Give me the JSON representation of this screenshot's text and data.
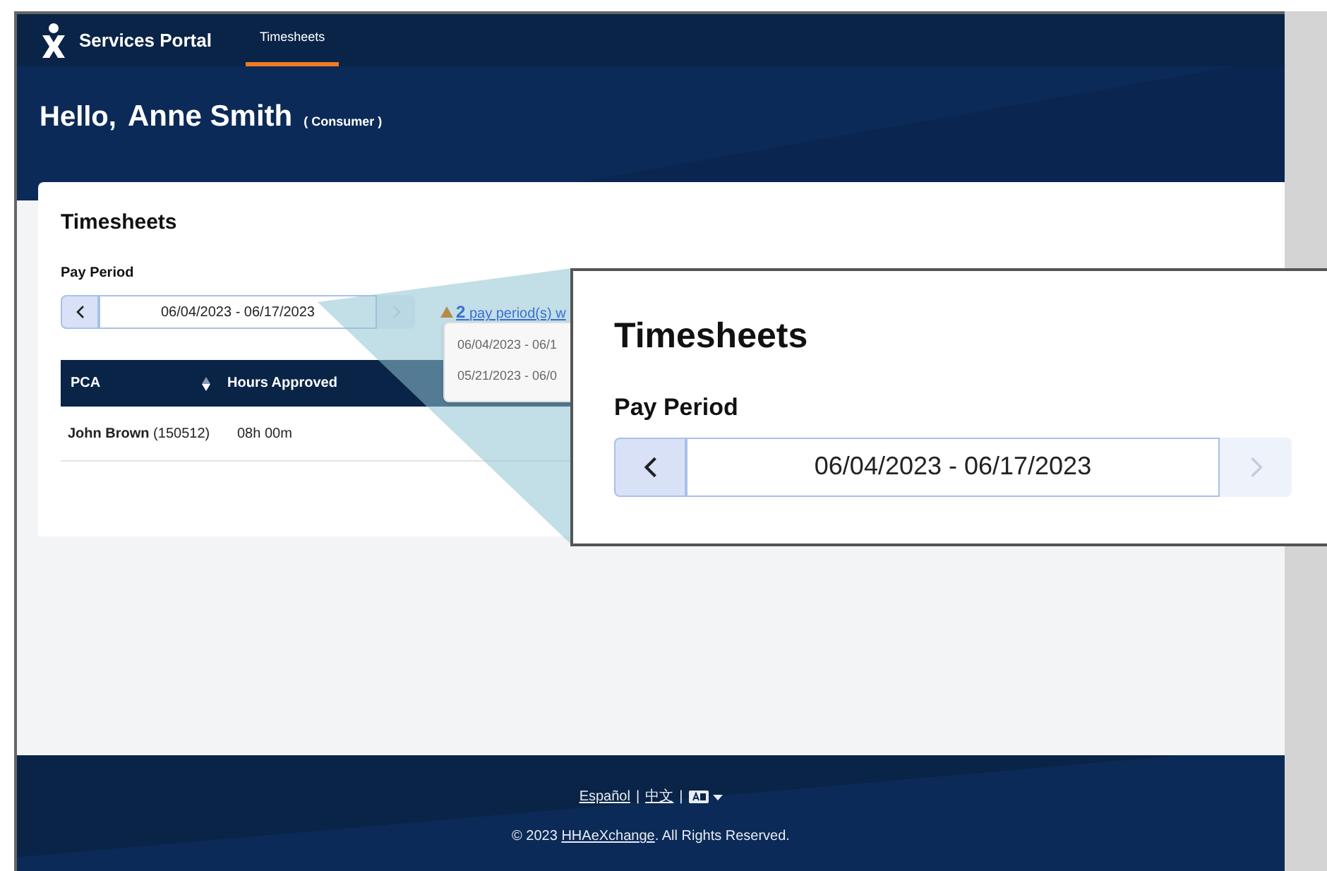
{
  "nav": {
    "brand": "Services Portal",
    "tabs": [
      {
        "label": "Timesheets",
        "selected": true
      }
    ]
  },
  "header": {
    "greeting": "Hello,",
    "name": "Anne Smith",
    "role": "( Consumer )"
  },
  "card": {
    "title": "Timesheets",
    "pay_period": {
      "label": "Pay Period",
      "value": "06/04/2023 - 06/17/2023",
      "next_disabled": true
    },
    "warning": {
      "count": "2",
      "text": "pay period(s) w"
    },
    "dropdown": [
      "06/04/2023 - 06/1",
      "05/21/2023 - 06/0"
    ],
    "table": {
      "columns": [
        "PCA",
        "Hours Approved"
      ],
      "rows": [
        {
          "name": "John Brown",
          "id": "(150512)",
          "hours": "08h 00m"
        }
      ]
    }
  },
  "callout": {
    "title": "Timesheets",
    "label": "Pay Period",
    "value": "06/04/2023 - 06/17/2023",
    "next_disabled": true
  },
  "footer": {
    "languages": [
      "Español",
      "中文"
    ],
    "separator": "|",
    "copyright_prefix": "© 2023 ",
    "company": "HHAeXchange",
    "copyright_suffix": ". All Rights Reserved."
  }
}
